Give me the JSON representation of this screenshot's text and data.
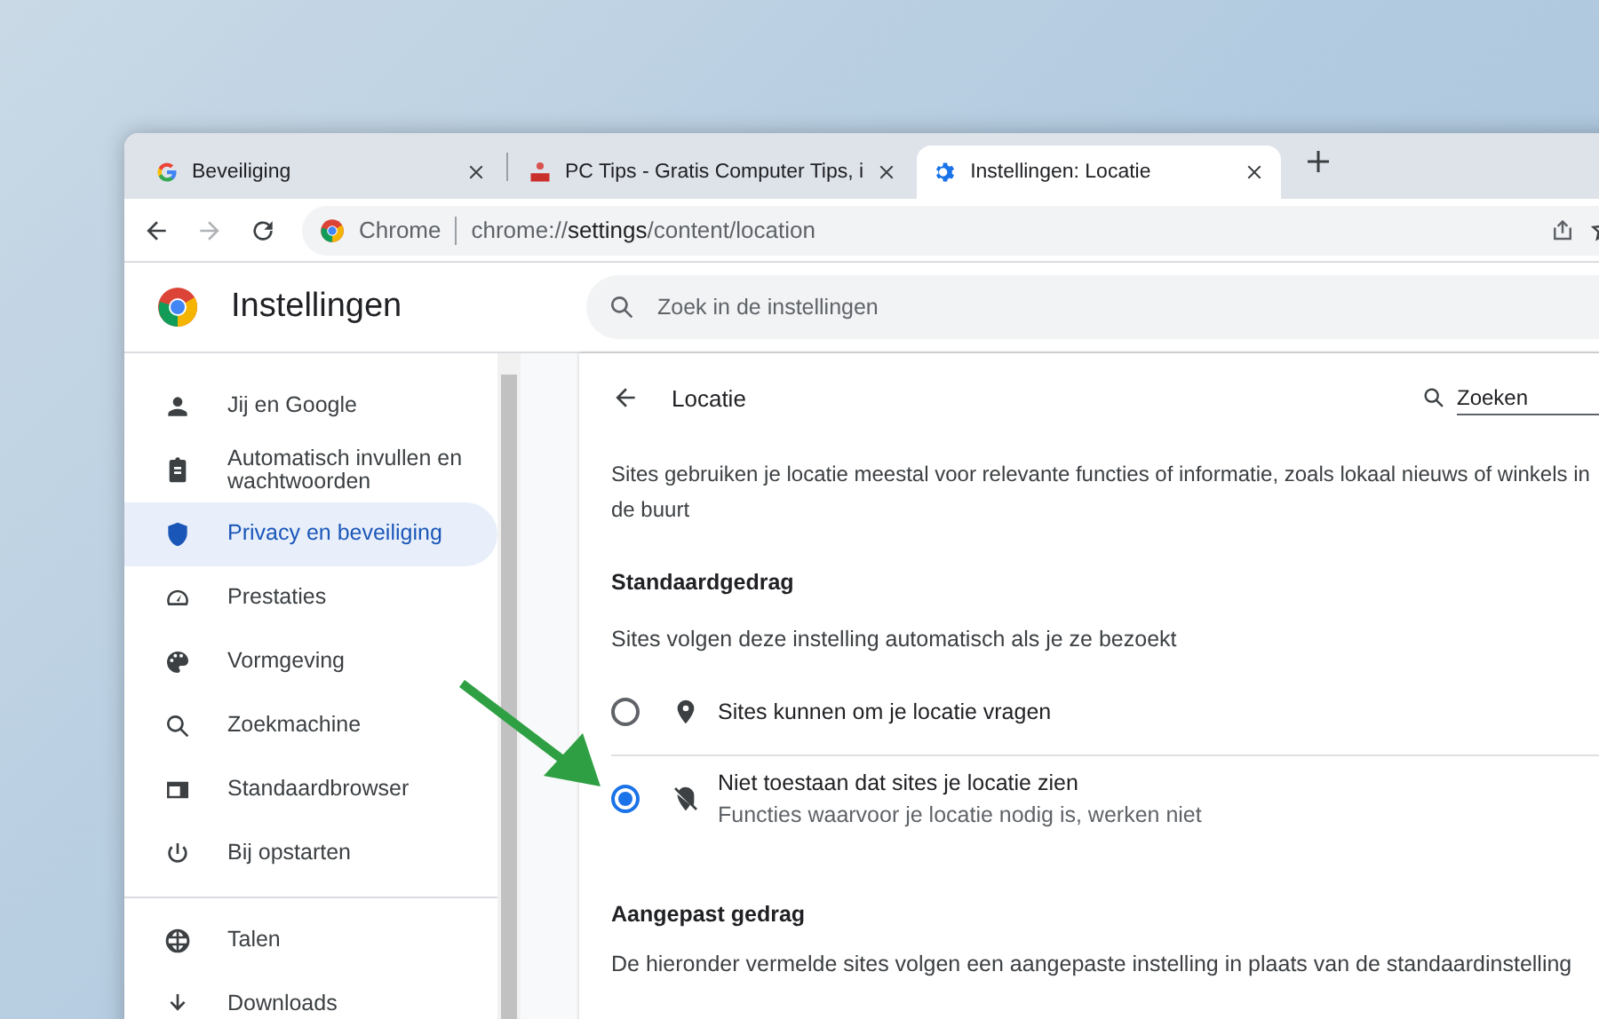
{
  "tabs": [
    {
      "title": "Beveiliging",
      "selected": false
    },
    {
      "title": "PC Tips - Gratis Computer Tips, i",
      "selected": false
    },
    {
      "title": "Instellingen: Locatie",
      "selected": true
    }
  ],
  "address_bar": {
    "site_label": "Chrome",
    "url_host": "chrome://",
    "url_path_bold": "settings",
    "url_rest": "/content/location"
  },
  "header": {
    "title": "Instellingen",
    "search_placeholder": "Zoek in de instellingen"
  },
  "sidebar": {
    "items": [
      {
        "label": "Jij en Google",
        "selected": false
      },
      {
        "label": "Automatisch invullen en wachtwoorden",
        "selected": false
      },
      {
        "label": "Privacy en beveiliging",
        "selected": true
      },
      {
        "label": "Prestaties",
        "selected": false
      },
      {
        "label": "Vormgeving",
        "selected": false
      },
      {
        "label": "Zoekmachine",
        "selected": false
      },
      {
        "label": "Standaardbrowser",
        "selected": false
      },
      {
        "label": "Bij opstarten",
        "selected": false
      },
      {
        "label": "Talen",
        "selected": false
      },
      {
        "label": "Downloads",
        "selected": false
      }
    ]
  },
  "page": {
    "title": "Locatie",
    "search_placeholder": "Zoeken",
    "description": "Sites gebruiken je locatie meestal voor relevante functies of informatie, zoals lokaal nieuws of winkels in de buurt",
    "default_heading": "Standaardgedrag",
    "default_subtitle": "Sites volgen deze instelling automatisch als je ze bezoekt",
    "options": [
      {
        "label": "Sites kunnen om je locatie vragen",
        "selected": false
      },
      {
        "label": "Niet toestaan dat sites je locatie zien",
        "sublabel": "Functies waarvoor je locatie nodig is, werken niet",
        "selected": true
      }
    ],
    "custom_heading": "Aangepast gedrag",
    "custom_subtitle": "De hieronder vermelde sites volgen een aangepaste instelling in plaats van de standaardinstelling"
  }
}
